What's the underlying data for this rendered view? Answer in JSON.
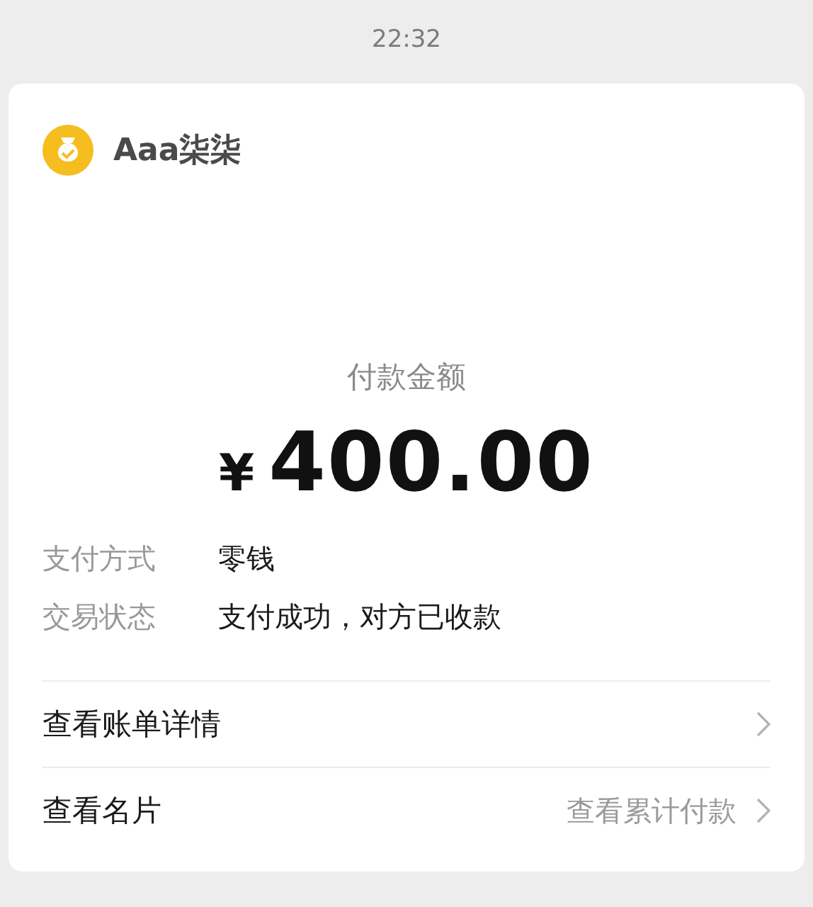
{
  "status_bar": {
    "time": "22:32"
  },
  "merchant": {
    "name": "Aaa柒柒"
  },
  "payment": {
    "label": "付款金额",
    "currency": "¥",
    "amount": "400.00"
  },
  "details": [
    {
      "label": "支付方式",
      "value": "零钱"
    },
    {
      "label": "交易状态",
      "value": "支付成功，对方已收款"
    }
  ],
  "links": [
    {
      "label": "查看账单详情"
    },
    {
      "label": "查看名片",
      "hint": "查看累计付款"
    }
  ]
}
